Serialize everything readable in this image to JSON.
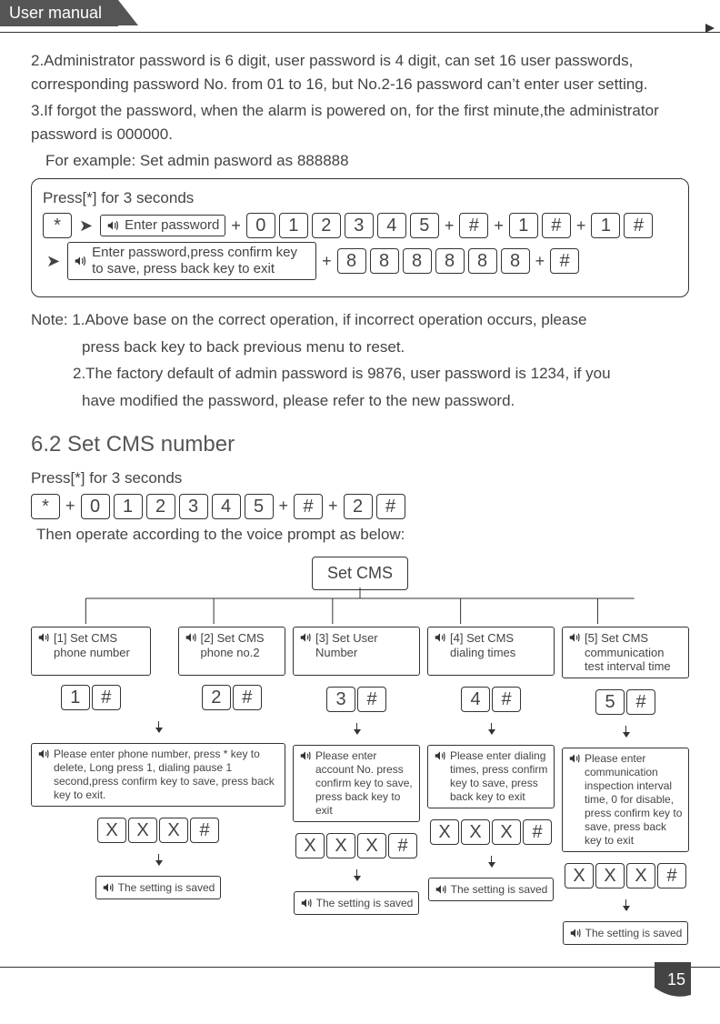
{
  "header": {
    "title": "User manual"
  },
  "intro": {
    "p2": "2.Administrator password is 6 digit, user password is 4 digit, can set 16 user passwords, corresponding password No. from 01 to 16, but No.2-16 password can’t enter user setting.",
    "p3": "3.If forgot the password, when the alarm is powered on, for the first minute,the administrator password is 000000.",
    "example": "For example: Set admin pasword as 888888"
  },
  "box1": {
    "press_label": "Press[*] for 3 seconds",
    "enter_pwd": "Enter password",
    "seq1": [
      "0",
      "1",
      "2",
      "3",
      "4",
      "5"
    ],
    "hash": "#",
    "one": "1",
    "star": "*",
    "enter_pwd2": "Enter password,press confirm key to save, press back key to exit",
    "seq2": [
      "8",
      "8",
      "8",
      "8",
      "8",
      "8"
    ]
  },
  "note": {
    "n1": "Note: 1.Above base on the correct operation, if incorrect operation occurs, please",
    "n1b": "press back key to back previous menu to reset.",
    "n2": "2.The factory default of admin password is 9876, user password is 1234, if you",
    "n2b": "have modified the password, please refer to the new password."
  },
  "section": {
    "title": "6.2 Set CMS number",
    "press_label": "Press[*] for 3 seconds",
    "seq": [
      "0",
      "1",
      "2",
      "3",
      "4",
      "5"
    ],
    "two": "2",
    "then": "Then operate according to the voice prompt as below:",
    "root": "Set CMS"
  },
  "branches": [
    {
      "opt": "[1] Set CMS phone number",
      "keys": [
        "1",
        "#"
      ],
      "prompt": "Please enter phone number, press * key to delete, Long press 1, dialing pause 1 second,press confirm key to save, press back key to exit.",
      "input": [
        "X",
        "X",
        "X",
        "#"
      ],
      "saved": "The setting is saved",
      "merged": true,
      "opt2": "[2] Set CMS phone no.2",
      "keys2": [
        "2",
        "#"
      ]
    },
    {
      "opt": "[3] Set User Number",
      "keys": [
        "3",
        "#"
      ],
      "prompt": "Please enter account No. press confirm key to save, press back key to exit",
      "input": [
        "X",
        "X",
        "X",
        "#"
      ],
      "saved": "The setting is saved"
    },
    {
      "opt": "[4] Set CMS dialing times",
      "keys": [
        "4",
        "#"
      ],
      "prompt": "Please enter dialing times, press confirm key to save, press back key to exit",
      "input": [
        "X",
        "X",
        "X",
        "#"
      ],
      "saved": "The setting is saved"
    },
    {
      "opt": "[5] Set CMS communication test interval time",
      "keys": [
        "5",
        "#"
      ],
      "prompt": "Please enter communication inspection interval time, 0 for disable, press confirm key to save, press back key to exit",
      "input": [
        "X",
        "X",
        "X",
        "#"
      ],
      "saved": "The setting is saved"
    }
  ],
  "page_number": "15",
  "plus": "+",
  "star": "*",
  "hash": "#"
}
